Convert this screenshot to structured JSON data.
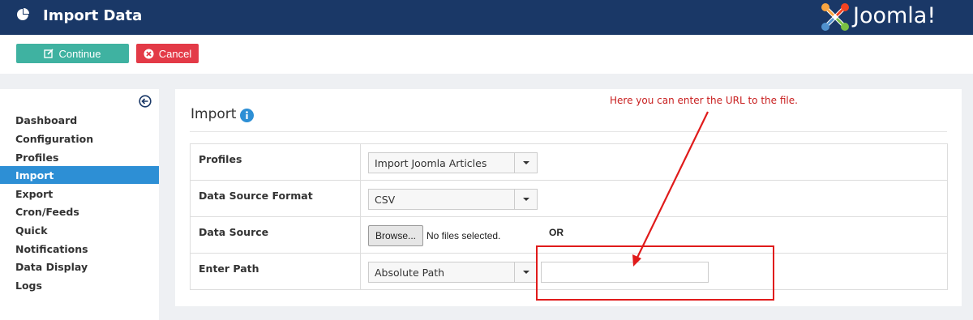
{
  "header": {
    "title": "Import Data",
    "brand": "Joomla!"
  },
  "toolbar": {
    "continue_label": "Continue",
    "cancel_label": "Cancel"
  },
  "sidebar": {
    "items": [
      {
        "label": "Dashboard"
      },
      {
        "label": "Configuration"
      },
      {
        "label": "Profiles"
      },
      {
        "label": "Import",
        "active": true
      },
      {
        "label": "Export"
      },
      {
        "label": "Cron/Feeds"
      },
      {
        "label": "Quick"
      },
      {
        "label": "Notifications"
      },
      {
        "label": "Data Display"
      },
      {
        "label": "Logs"
      }
    ]
  },
  "panel": {
    "title": "Import",
    "rows": {
      "profiles": {
        "label": "Profiles",
        "value": "Import Joomla Articles"
      },
      "format": {
        "label": "Data Source Format",
        "value": "CSV"
      },
      "source": {
        "label": "Data Source",
        "browse_label": "Browse...",
        "no_file": "No files selected.",
        "or": "OR"
      },
      "path": {
        "label": "Enter Path",
        "value": "Absolute Path",
        "input_value": ""
      }
    }
  },
  "annotation": {
    "text": "Here you can enter the URL to the file."
  },
  "colors": {
    "header": "#1a3867",
    "continue": "#3fb2a1",
    "cancel": "#e33a47",
    "active_nav": "#2d8fd5",
    "annotation": "#e01b1b"
  }
}
